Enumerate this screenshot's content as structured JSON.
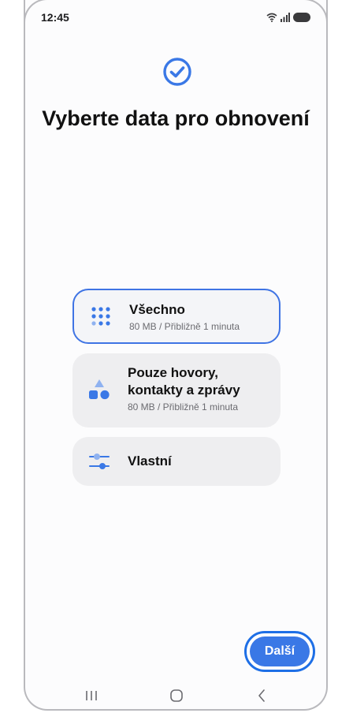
{
  "status_bar": {
    "time": "12:45",
    "icons": [
      "wifi-icon",
      "signal-icon",
      "battery-icon"
    ]
  },
  "header": {
    "icon": "check-circle-icon",
    "title": "Vyberte data pro obnovení"
  },
  "options": [
    {
      "label": "Všechno",
      "sub": "80 MB / Přibližně 1 minuta",
      "icon": "grid-dots-icon",
      "selected": true
    },
    {
      "label": "Pouze hovory, kontakty a zprávy",
      "sub": "80 MB / Přibližně 1 minuta",
      "icon": "shapes-icon",
      "selected": false
    },
    {
      "label": "Vlastní",
      "icon": "sliders-icon",
      "selected": false
    }
  ],
  "footer": {
    "next_label": "Další"
  },
  "nav_bar": {
    "icons": [
      "recent-apps-icon",
      "home-icon",
      "back-icon"
    ]
  },
  "colors": {
    "accent": "#3a78e6",
    "selected_border": "#3f74e4",
    "card_bg": "#eeeef0"
  }
}
